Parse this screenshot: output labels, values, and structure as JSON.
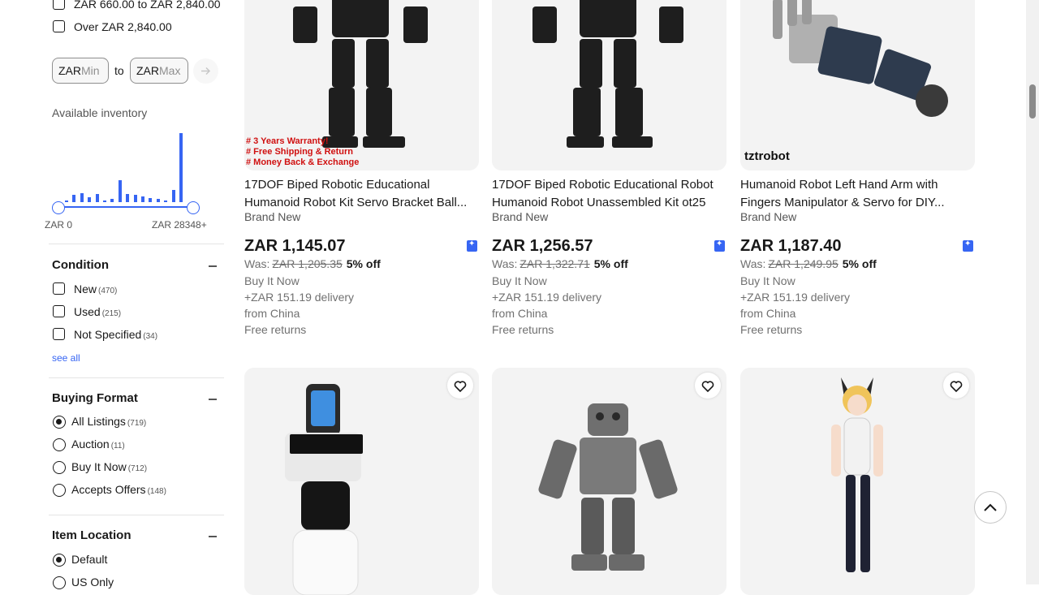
{
  "price_filter": {
    "options": [
      {
        "label": "ZAR 660.00 to ZAR 2,840.00"
      },
      {
        "label": "Over ZAR 2,840.00"
      }
    ],
    "min_prefix": "ZAR",
    "min_placeholder": "Min",
    "to_label": "to",
    "max_prefix": "ZAR",
    "max_placeholder": "Max",
    "go_icon": "arrow-right-icon"
  },
  "inventory": {
    "label": "Available inventory",
    "histogram": [
      2,
      7,
      9,
      5,
      8,
      1,
      3,
      22,
      8,
      7,
      6,
      4,
      3,
      2,
      12,
      68
    ],
    "min_label": "ZAR 0",
    "max_label": "ZAR 28348+"
  },
  "condition": {
    "title": "Condition",
    "options": [
      {
        "label": "New",
        "count": "(470)"
      },
      {
        "label": "Used",
        "count": "(215)"
      },
      {
        "label": "Not Specified",
        "count": "(34)"
      }
    ],
    "see_all": "see all"
  },
  "buying_format": {
    "title": "Buying Format",
    "options": [
      {
        "label": "All Listings",
        "count": "(719)",
        "selected": true
      },
      {
        "label": "Auction",
        "count": "(11)",
        "selected": false
      },
      {
        "label": "Buy It Now",
        "count": "(712)",
        "selected": false
      },
      {
        "label": "Accepts Offers",
        "count": "(148)",
        "selected": false
      }
    ]
  },
  "item_location": {
    "title": "Item Location",
    "options": [
      {
        "label": "Default",
        "selected": true
      },
      {
        "label": "US Only",
        "selected": false
      }
    ]
  },
  "products": [
    {
      "title": "17DOF Biped Robotic Educational Humanoid Robot Kit Servo Bracket Ball...",
      "condition": "Brand New",
      "price": "ZAR 1,145.07",
      "was_label": "Was:",
      "was_price": "ZAR 1,205.35",
      "discount": "5% off",
      "format": "Buy It Now",
      "delivery": "+ZAR 151.19 delivery",
      "origin": "from China",
      "returns": "Free returns",
      "image_overlay": [
        "# 3 Years Warranty!",
        "# Free Shipping & Return",
        "# Money Back & Exchange"
      ]
    },
    {
      "title": "17DOF Biped Robotic Educational Robot Humanoid Robot Unassembled Kit ot25",
      "condition": "Brand New",
      "price": "ZAR 1,256.57",
      "was_label": "Was:",
      "was_price": "ZAR 1,322.71",
      "discount": "5% off",
      "format": "Buy It Now",
      "delivery": "+ZAR 151.19 delivery",
      "origin": "from China",
      "returns": "Free returns"
    },
    {
      "title": "Humanoid Robot Left Hand Arm with Fingers Manipulator & Servo for DIY...",
      "condition": "Brand New",
      "price": "ZAR 1,187.40",
      "was_label": "Was:",
      "was_price": "ZAR 1,249.95",
      "discount": "5% off",
      "format": "Buy It Now",
      "delivery": "+ZAR 151.19 delivery",
      "origin": "from China",
      "returns": "Free returns",
      "image_logo": "tztrobot"
    }
  ],
  "colors": {
    "accent": "#3665f3",
    "text": "#191919",
    "muted": "#707070"
  },
  "icons": {
    "watch": "heart-icon",
    "back_to_top": "chevron-up-icon",
    "sponsored": "star-badge-icon"
  }
}
